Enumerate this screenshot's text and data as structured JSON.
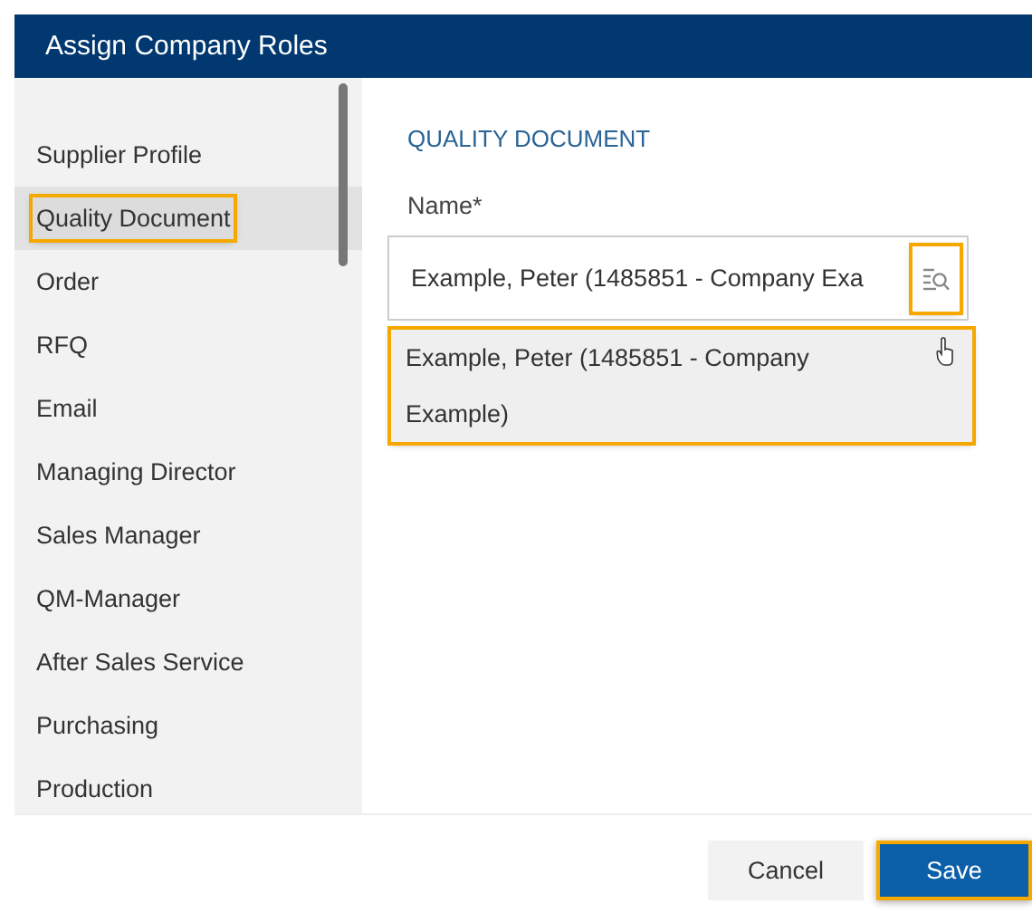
{
  "window": {
    "title": "Assign Company Roles"
  },
  "sidebar": {
    "items": [
      {
        "label": "Supplier Profile",
        "selected": false,
        "highlighted": false
      },
      {
        "label": "Quality Document",
        "selected": true,
        "highlighted": true
      },
      {
        "label": "Order",
        "selected": false,
        "highlighted": false
      },
      {
        "label": "RFQ",
        "selected": false,
        "highlighted": false
      },
      {
        "label": "Email",
        "selected": false,
        "highlighted": false
      },
      {
        "label": "Managing Director",
        "selected": false,
        "highlighted": false
      },
      {
        "label": "Sales Manager",
        "selected": false,
        "highlighted": false
      },
      {
        "label": "QM-Manager",
        "selected": false,
        "highlighted": false
      },
      {
        "label": "After Sales Service",
        "selected": false,
        "highlighted": false
      },
      {
        "label": "Purchasing",
        "selected": false,
        "highlighted": false
      },
      {
        "label": "Production",
        "selected": false,
        "highlighted": false
      }
    ]
  },
  "form": {
    "section_title": "QUALITY DOCUMENT",
    "field": {
      "label": "Name*",
      "value": "Example, Peter (1485851 - Company Exa",
      "search_highlighted": true
    },
    "suggestions": [
      {
        "label": "Example, Peter (1485851 - Company Example)",
        "highlighted": true
      }
    ]
  },
  "buttons": [
    {
      "label": "Cancel",
      "kind": "secondary",
      "highlighted": false
    },
    {
      "label": "Save",
      "kind": "primary",
      "highlighted": true
    }
  ]
}
